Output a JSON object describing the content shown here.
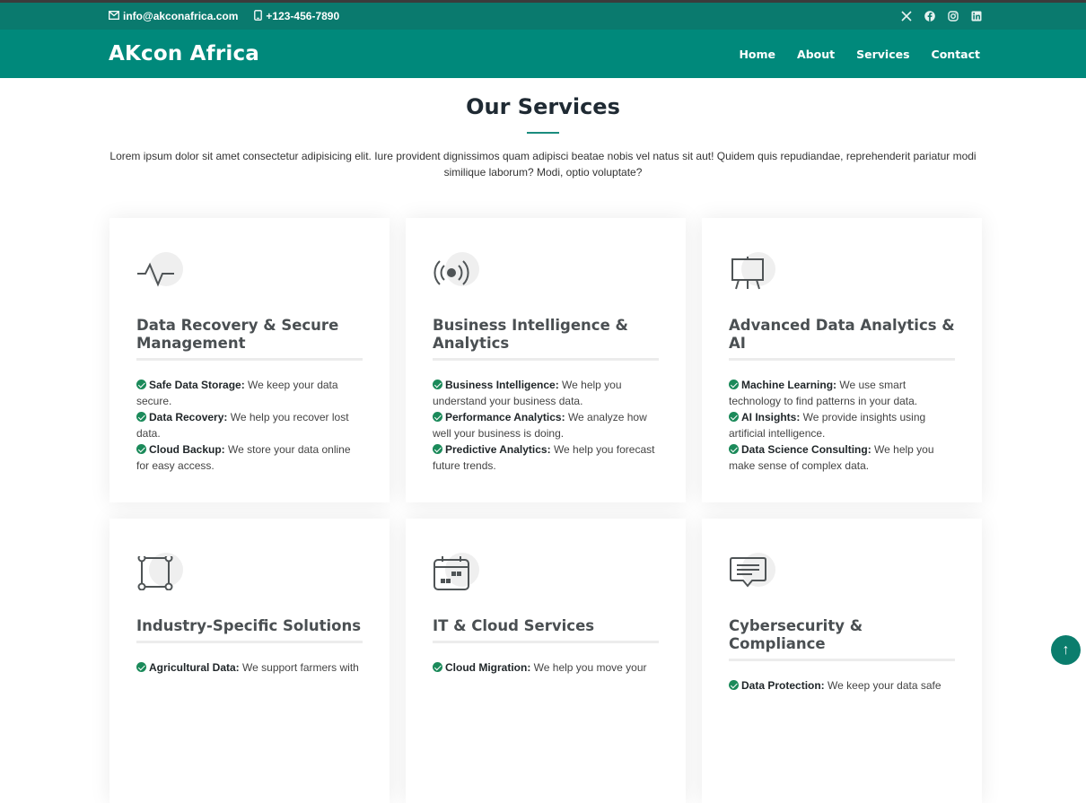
{
  "topbar": {
    "email": "info@akconafrica.com",
    "phone": "+123-456-7890",
    "social_icons": [
      "x-icon",
      "facebook-icon",
      "instagram-icon",
      "linkedin-icon"
    ]
  },
  "navbar": {
    "brand": "AKcon Africa",
    "links": [
      "Home",
      "About",
      "Services",
      "Contact"
    ]
  },
  "services": {
    "title": "Our Services",
    "intro": "Lorem ipsum dolor sit amet consectetur adipisicing elit. Iure provident dignissimos quam adipisci beatae nobis vel natus sit aut! Quidem quis repudiandae, reprehenderit pariatur modi similique laborum? Modi, optio voluptate?",
    "cards": [
      {
        "icon": "activity-icon",
        "title": "Data Recovery & Secure Management",
        "items": [
          {
            "label": "Safe Data Storage:",
            "text": " We keep your data secure."
          },
          {
            "label": "Data Recovery:",
            "text": " We help you recover lost data."
          },
          {
            "label": "Cloud Backup:",
            "text": " We store your data online for easy access."
          }
        ]
      },
      {
        "icon": "broadcast-icon",
        "title": "Business Intelligence & Analytics",
        "items": [
          {
            "label": "Business Intelligence:",
            "text": " We help you understand your business data."
          },
          {
            "label": "Performance Analytics:",
            "text": " We analyze how well your business is doing."
          },
          {
            "label": "Predictive Analytics:",
            "text": " We help you forecast future trends."
          }
        ]
      },
      {
        "icon": "easel-icon",
        "title": "Advanced Data Analytics & AI",
        "items": [
          {
            "label": "Machine Learning:",
            "text": " We use smart technology to find patterns in your data."
          },
          {
            "label": "AI Insights:",
            "text": " We provide insights using artificial intelligence."
          },
          {
            "label": "Data Science Consulting:",
            "text": " We help you make sense of complex data."
          }
        ]
      },
      {
        "icon": "bounding-box-icon",
        "title": "Industry-Specific Solutions",
        "items": [
          {
            "label": "Agricultural Data:",
            "text": " We support farmers with"
          }
        ]
      },
      {
        "icon": "calendar-icon",
        "title": "IT & Cloud Services",
        "items": [
          {
            "label": "Cloud Migration:",
            "text": " We help you move your"
          }
        ]
      },
      {
        "icon": "chat-icon",
        "title": "Cybersecurity & Compliance",
        "items": [
          {
            "label": "Data Protection:",
            "text": " We keep your data safe"
          }
        ]
      }
    ]
  },
  "scroll_top": "↑",
  "colors": {
    "topbar": "#0a7a6e",
    "navbar": "#00897b",
    "check": "#1b8a5a",
    "accent": "#1a8c7e"
  }
}
